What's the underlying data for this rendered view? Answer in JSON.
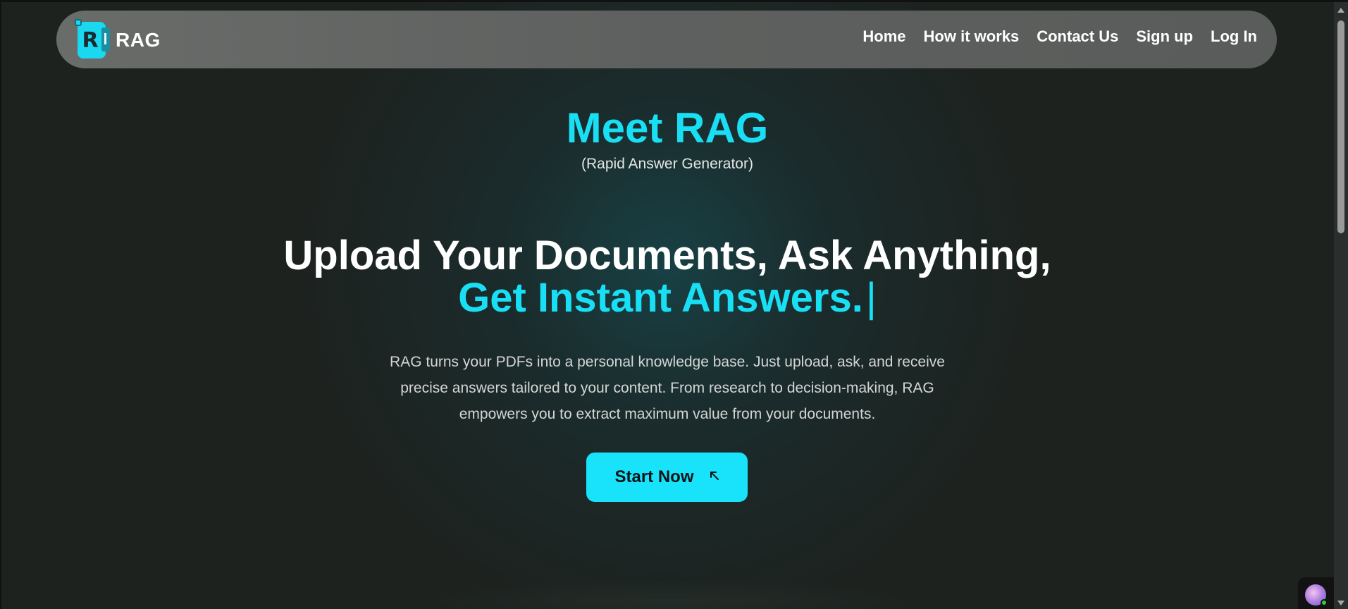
{
  "brand": {
    "name": "RAG",
    "logo_letter": "R"
  },
  "nav": {
    "links": [
      "Home",
      "How it works",
      "Contact Us",
      "Sign up",
      "Log In"
    ]
  },
  "hero": {
    "title": "Meet RAG",
    "subtitle": "(Rapid Answer Generator)",
    "headline_line1": "Upload Your Documents, Ask Anything,",
    "headline_line2": "Get Instant Answers.",
    "caret": "|",
    "description_lines": [
      "RAG turns your PDFs into a personal knowledge base. Just upload, ask, and receive",
      "precise answers tailored to your content. From research to decision-making, RAG",
      "empowers you to extract maximum value from your documents."
    ],
    "cta_label": "Start Now",
    "cta_icon": "arrow-up-left-icon"
  },
  "colors": {
    "accent": "#19dff5",
    "background": "#1d221f",
    "navbar": "#5e605f",
    "button": "#19e2fb"
  }
}
